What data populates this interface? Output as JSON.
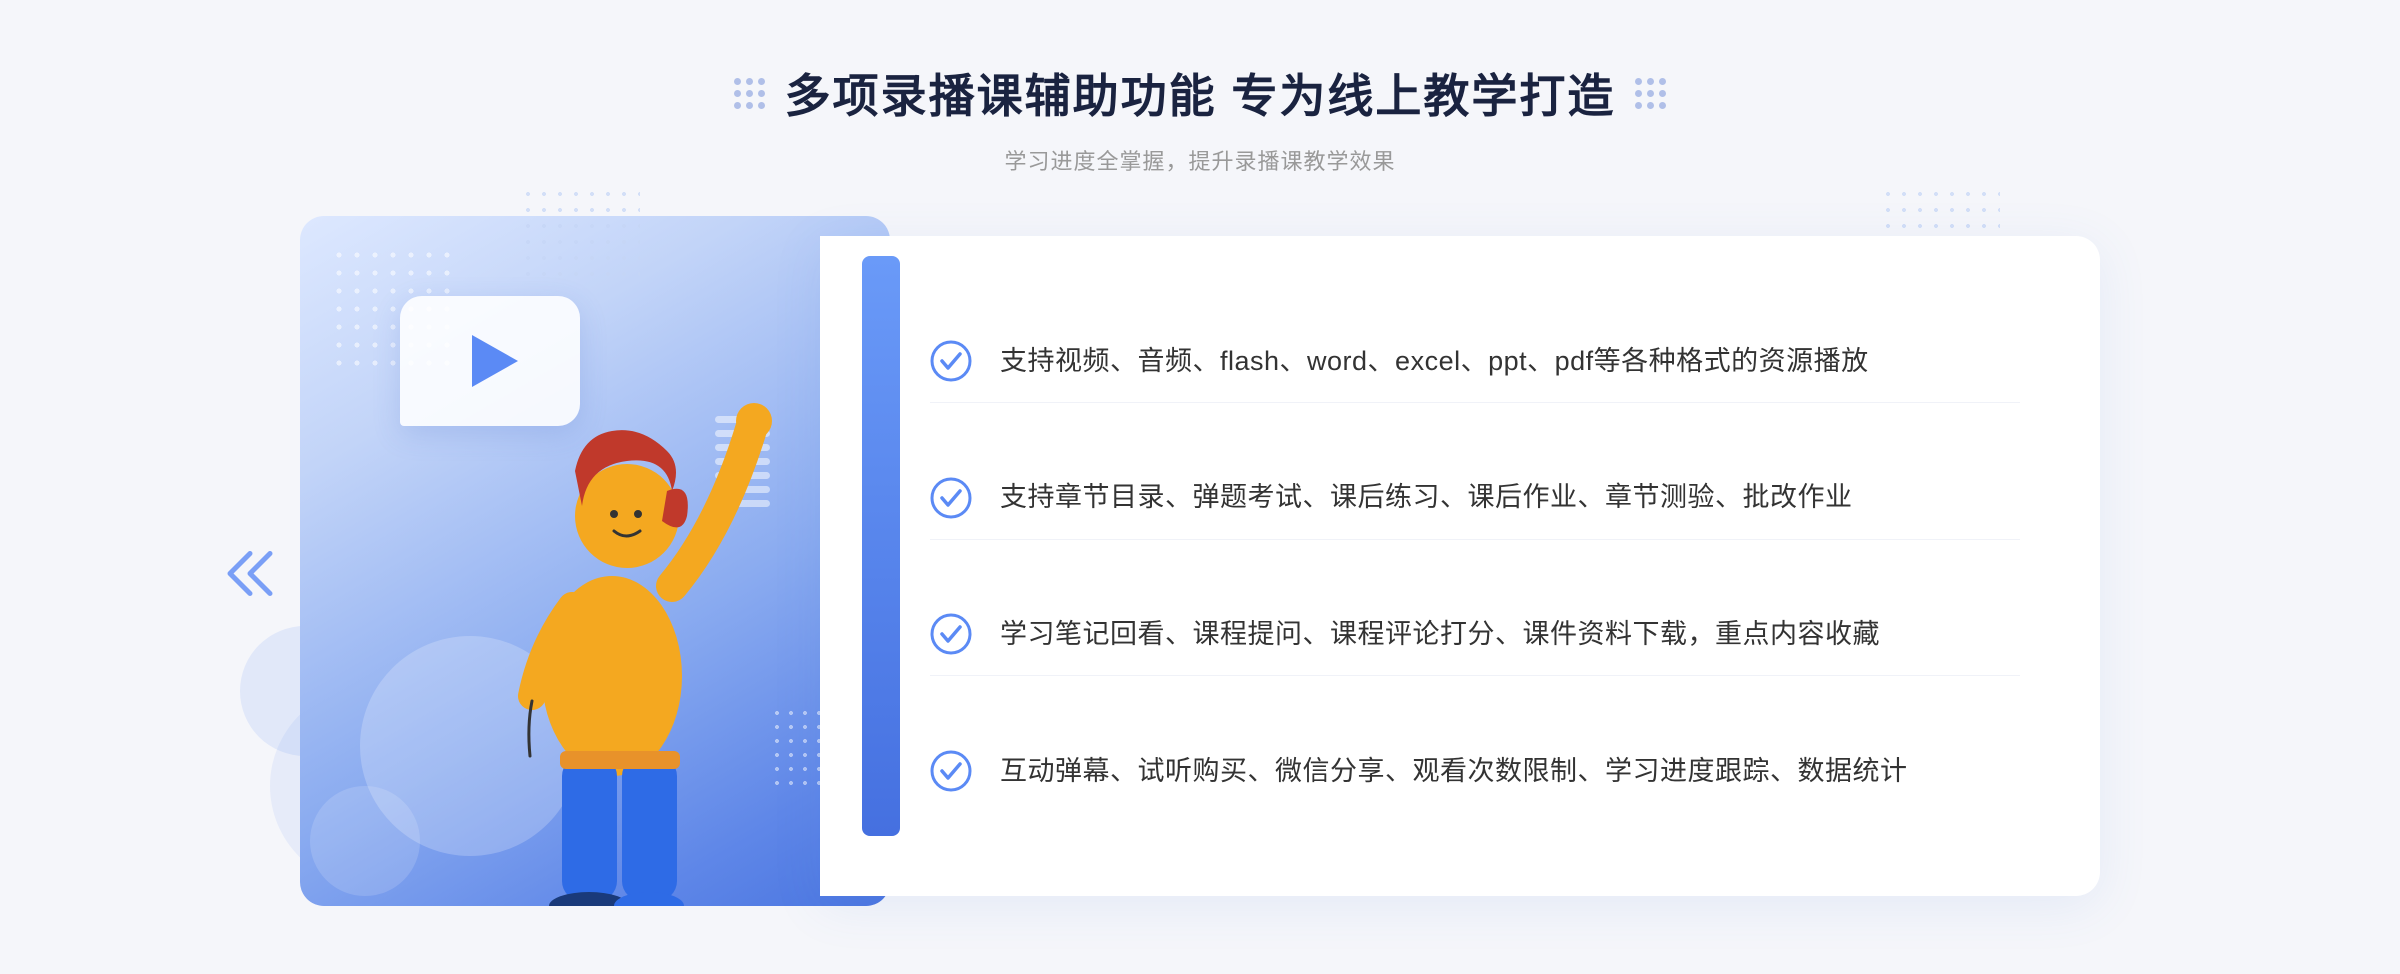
{
  "page": {
    "background": "#f5f6fa"
  },
  "header": {
    "title": "多项录播课辅助功能 专为线上教学打造",
    "subtitle": "学习进度全掌握，提升录播课教学效果"
  },
  "features": [
    {
      "id": "feature-1",
      "text": "支持视频、音频、flash、word、excel、ppt、pdf等各种格式的资源播放"
    },
    {
      "id": "feature-2",
      "text": "支持章节目录、弹题考试、课后练习、课后作业、章节测验、批改作业"
    },
    {
      "id": "feature-3",
      "text": "学习笔记回看、课程提问、课程评论打分、课件资料下载，重点内容收藏"
    },
    {
      "id": "feature-4",
      "text": "互动弹幕、试听购买、微信分享、观看次数限制、学习进度跟踪、数据统计"
    }
  ],
  "icons": {
    "check": "check-circle-icon",
    "play": "play-icon",
    "chevron": "chevron-right-icon"
  },
  "colors": {
    "primary": "#5b8af5",
    "title": "#1a2340",
    "subtitle": "#999999",
    "text": "#333333",
    "border": "#f0f2f8",
    "white": "#ffffff"
  }
}
